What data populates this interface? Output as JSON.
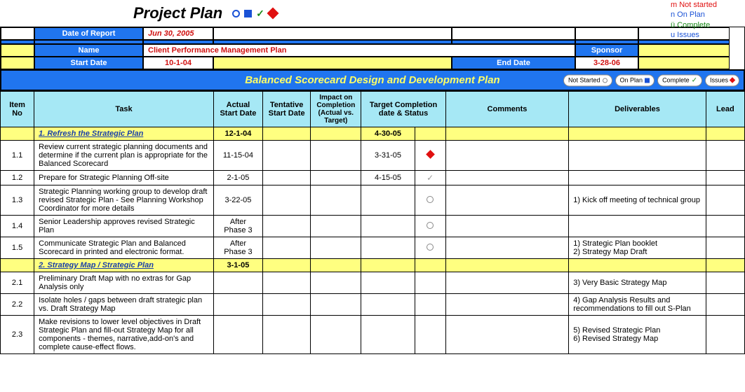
{
  "title": "Project Plan",
  "legend": {
    "not_started": "m Not started",
    "on_plan": "n On Plan",
    "complete": "ü Complete",
    "issues": "u Issues"
  },
  "meta": {
    "date_of_report_label": "Date of Report",
    "date_of_report": "Jun 30, 2005",
    "name_label": "Name",
    "name": "Client Performance Management Plan",
    "sponsor_label": "Sponsor",
    "start_date_label": "Start Date",
    "start_date": "10-1-04",
    "end_date_label": "End Date",
    "end_date": "3-28-06"
  },
  "banner": "Balanced Scorecard Design and Development Plan",
  "banner_buttons": {
    "not_started": "Not Started",
    "on_plan": "On Plan",
    "complete": "Complete",
    "issues": "Issues"
  },
  "columns": {
    "item_no": "Item No",
    "task": "Task",
    "actual_start": "Actual Start Date",
    "tentative_start": "Tentative Start Date",
    "impact": "Impact on Completion (Actual vs. Target)",
    "target_completion": "Target Completion date & Status",
    "comments": "Comments",
    "deliverables": "Deliverables",
    "lead": "Lead"
  },
  "sections": [
    {
      "num": null,
      "label": "1. Refresh the Strategic Plan",
      "actual_start": "12-1-04",
      "target": "4-30-05",
      "rows": [
        {
          "num": "1.1",
          "task": "Review current strategic planning documents and determine if the current plan is appropriate for the Balanced Scorecard",
          "actual_start": "11-15-04",
          "target": "3-31-05",
          "status": "diamond",
          "deliv": ""
        },
        {
          "num": "1.2",
          "task": "Prepare for Strategic Planning Off-site",
          "actual_start": "2-1-05",
          "target": "4-15-05",
          "status": "check",
          "deliv": ""
        },
        {
          "num": "1.3",
          "task": "Strategic Planning working group to develop draft revised Strategic Plan - See Planning Workshop Coordinator for more details",
          "actual_start": "3-22-05",
          "target": "",
          "status": "radio",
          "deliv": "1) Kick off meeting of technical group"
        },
        {
          "num": "1.4",
          "task": "Senior Leadership approves revised Strategic Plan",
          "actual_start": "After Phase 3",
          "target": "",
          "status": "radio",
          "deliv": ""
        },
        {
          "num": "1.5",
          "task": "Communicate Strategic Plan and Balanced Scorecard in printed and electronic format.",
          "actual_start": "After Phase 3",
          "target": "",
          "status": "radio",
          "deliv": "1) Strategic Plan booklet\n2) Strategy Map Draft"
        }
      ]
    },
    {
      "num": null,
      "label": "2. Strategy Map / Strategic Plan",
      "actual_start": "3-1-05",
      "target": "",
      "rows": [
        {
          "num": "2.1",
          "task": "Preliminary Draft Map with no extras for Gap Analysis only",
          "actual_start": "",
          "target": "",
          "status": "",
          "deliv": "3) Very Basic Strategy Map"
        },
        {
          "num": "2.2",
          "task": "Isolate holes / gaps between draft strategic plan vs. Draft Strategy Map",
          "actual_start": "",
          "target": "",
          "status": "",
          "deliv": "4) Gap Analysis Results and recommendations to fill out S-Plan"
        },
        {
          "num": "2.3",
          "task": "Make revisions to lower level objectives in Draft Strategic Plan and fill-out Strategy Map for all components - themes, narrative,add-on's and complete cause-effect flows.",
          "actual_start": "",
          "target": "",
          "status": "",
          "deliv": "5) Revised Strategic Plan\n6) Revised Strategy Map"
        }
      ]
    }
  ]
}
